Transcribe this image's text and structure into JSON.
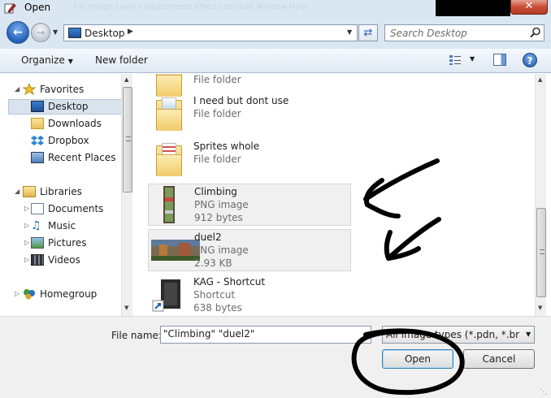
{
  "window": {
    "title": "Open",
    "ghost_menu": "File    Image    Layers    Adjustments    Effects    Utilities    Window    Help",
    "close_glyph": "✕"
  },
  "address": {
    "location": "Desktop",
    "search_placeholder": "Search Desktop"
  },
  "toolbar": {
    "organize_label": "Organize",
    "new_folder_label": "New folder",
    "help_glyph": "?"
  },
  "nav": {
    "favorites": "Favorites",
    "desktop": "Desktop",
    "downloads": "Downloads",
    "dropbox": "Dropbox",
    "recent_places": "Recent Places",
    "libraries": "Libraries",
    "documents": "Documents",
    "music": "Music",
    "pictures": "Pictures",
    "videos": "Videos",
    "homegroup": "Homegroup"
  },
  "files": [
    {
      "name": "",
      "type": "File folder",
      "size": ""
    },
    {
      "name": "I need but dont use",
      "type": "File folder",
      "size": ""
    },
    {
      "name": "Sprites whole",
      "type": "File folder",
      "size": ""
    },
    {
      "name": "Climbing",
      "type": "PNG image",
      "size": "912 bytes"
    },
    {
      "name": "duel2",
      "type": "PNG image",
      "size": "2.93 KB"
    },
    {
      "name": "KAG - Shortcut",
      "type": "Shortcut",
      "size": "638 bytes"
    }
  ],
  "bottom": {
    "file_name_label": "File name:",
    "file_name_value": "\"Climbing\" \"duel2\"",
    "file_type_value": "All image types (*.pdn, *.bmp, *.gif, *.jpg, *.jpeg, *.png)",
    "open_label": "Open",
    "cancel_label": "Cancel"
  },
  "colors": {
    "chrome_blue": "#dbe6f3",
    "selection": "#d9e3ee",
    "annotation_ink": "#000000"
  }
}
